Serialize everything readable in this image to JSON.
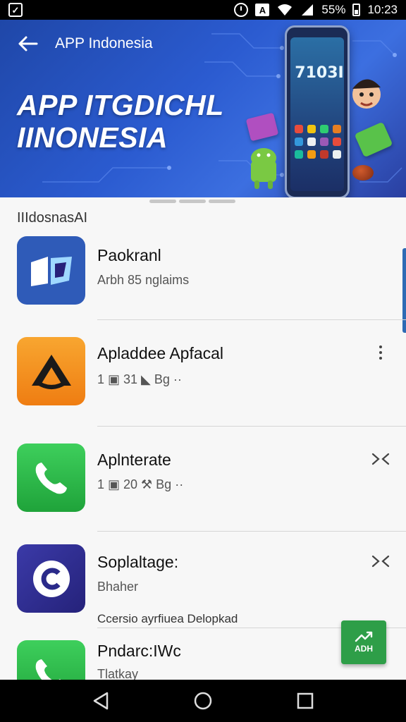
{
  "status_bar": {
    "battery_text": "55%",
    "time": "10:23",
    "icons": [
      "check-box-icon",
      "alarm-icon",
      "a-badge-icon",
      "wifi-icon",
      "signal-icon",
      "battery-icon"
    ]
  },
  "app_bar": {
    "title": "APP Indonesia",
    "back_icon": "arrow-left-icon"
  },
  "banner": {
    "hero_line_1": "APP ITGDICHL",
    "hero_line_2": "IINONESIA",
    "phone_clock": "7103I",
    "colors": {
      "banner_start": "#1f47a8",
      "banner_end": "#3c6fe0"
    }
  },
  "list": {
    "section_title": "IIIdosnasAI",
    "items": [
      {
        "name": "Paokranl",
        "subtitle": "Arbh 85 nglaims",
        "action": ""
      },
      {
        "name": "Apladdee Apfacal",
        "subtitle": "1 ▣ 31 ◣ Bg ··",
        "action": "more-vert-icon"
      },
      {
        "name": "Aplnterate",
        "subtitle": "1 ▣ 20 ⚒ Bg ··",
        "action": "shuffle-icon"
      },
      {
        "name": "Soplaltage:",
        "subtitle": "Bhaher",
        "description": "Ccersio ayrfiuea Delopkad",
        "action": "shuffle-icon"
      },
      {
        "name": "Pndarc:IWc",
        "subtitle": "Tlatkay",
        "action": ""
      }
    ]
  },
  "fab": {
    "label": "ADH",
    "icon": "trend-up-icon",
    "color": "#2e9e48"
  },
  "nav_bar": {
    "icons": [
      "back-triangle-icon",
      "home-circle-icon",
      "recents-square-icon"
    ]
  }
}
